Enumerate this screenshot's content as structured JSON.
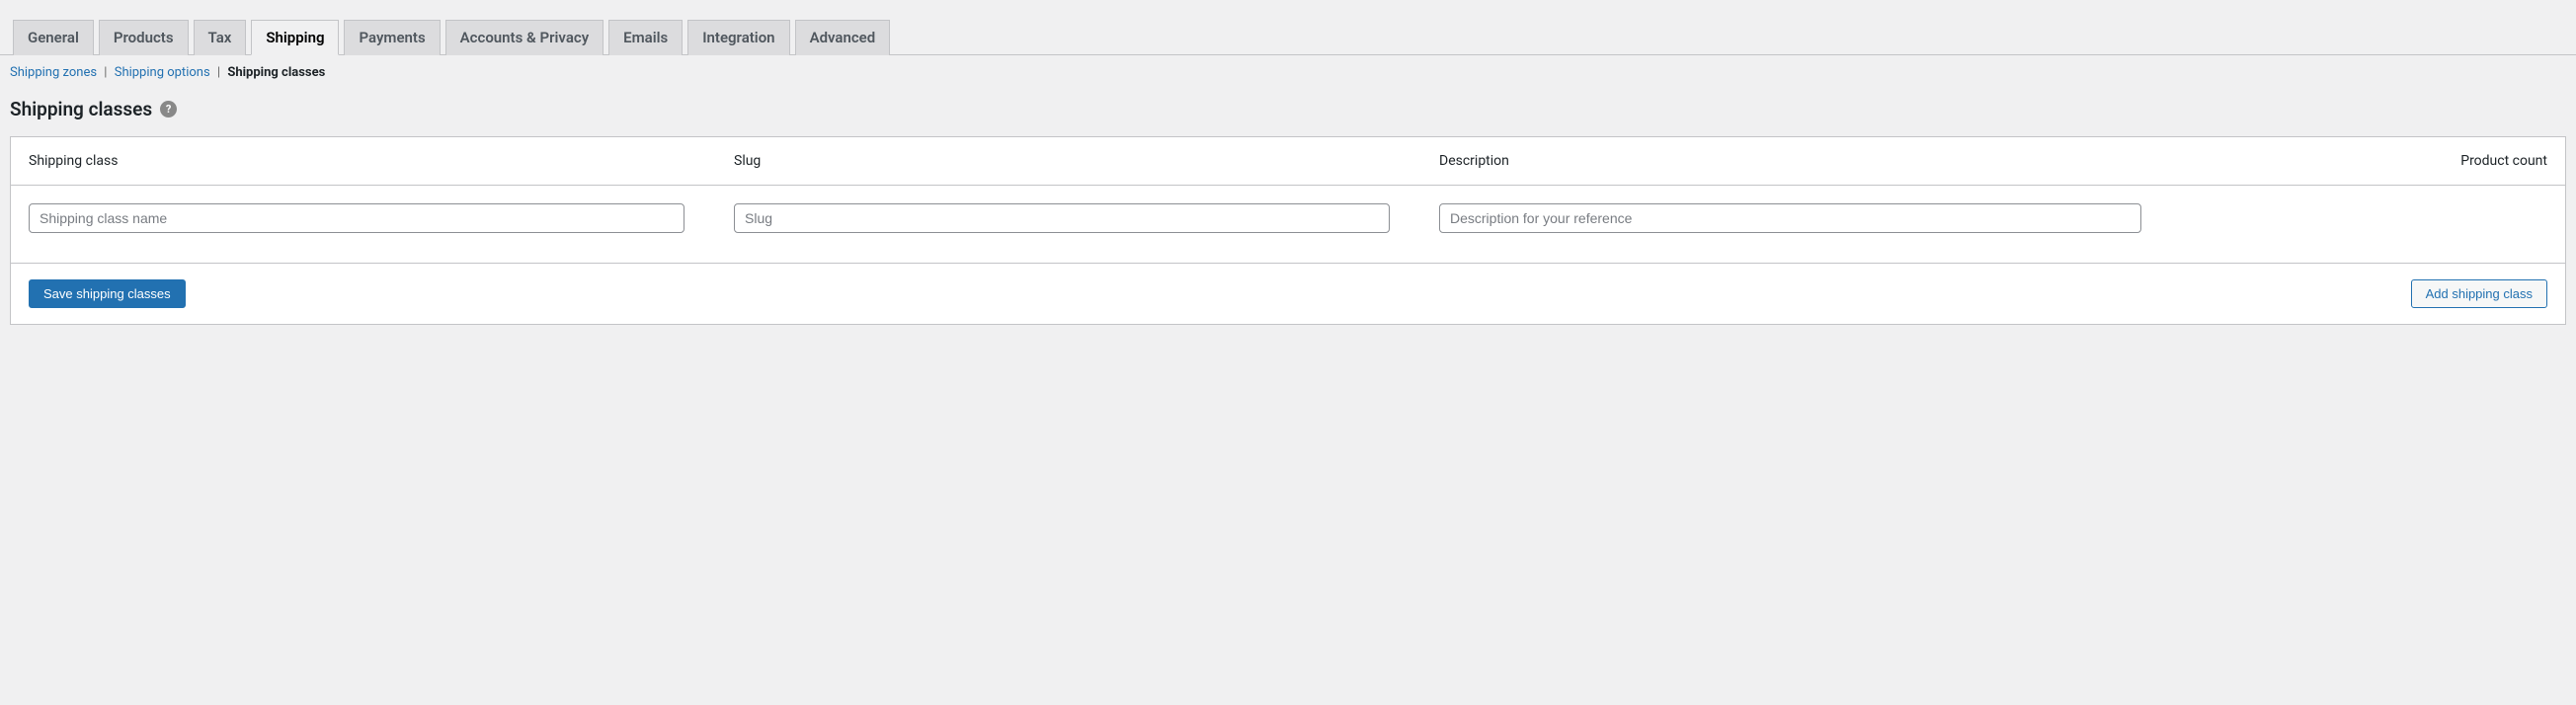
{
  "tabs": [
    {
      "label": "General"
    },
    {
      "label": "Products"
    },
    {
      "label": "Tax"
    },
    {
      "label": "Shipping",
      "active": true
    },
    {
      "label": "Payments"
    },
    {
      "label": "Accounts & Privacy"
    },
    {
      "label": "Emails"
    },
    {
      "label": "Integration"
    },
    {
      "label": "Advanced"
    }
  ],
  "subnav": {
    "zones": "Shipping zones",
    "options": "Shipping options",
    "classes": "Shipping classes"
  },
  "page_title": "Shipping classes",
  "help_icon": "?",
  "columns": {
    "class": "Shipping class",
    "slug": "Slug",
    "description": "Description",
    "count": "Product count"
  },
  "placeholders": {
    "class": "Shipping class name",
    "slug": "Slug",
    "description": "Description for your reference"
  },
  "buttons": {
    "save": "Save shipping classes",
    "add": "Add shipping class"
  }
}
